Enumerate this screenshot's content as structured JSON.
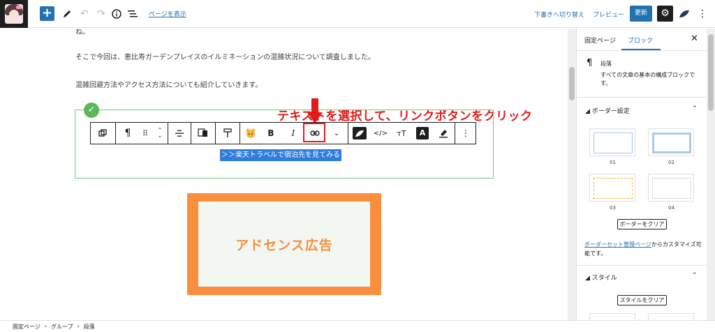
{
  "topbar": {
    "add_icon": "plus-icon",
    "view_page_label": "ページを表示",
    "save_draft_label": "下書きへ切り替え",
    "preview_label": "プレビュー",
    "update_label": "更新"
  },
  "content": {
    "partial_text": "ね。",
    "para1": "そこで今回は、恵比寿ガーデンプレイスのイルミネーションの混雑状況について調査しました。",
    "para2": "混雑回避方法やアクセス方法についても紹介していきます。",
    "annotation": "テキストを選択して、リンクボタンをクリック",
    "selected_link_text": "＞＞楽天トラベルで宿泊先を見てみる",
    "ad_label": "アドセンス広告"
  },
  "toolbar": {
    "bold_label": "B",
    "italic_label": "I",
    "text_color_label": "A"
  },
  "sidebar": {
    "tab_page": "固定ページ",
    "tab_block": "ブロック",
    "block_title": "段落",
    "block_desc": "すべての文章の基本の構成ブロックです。",
    "border_section": "ボーダー設定",
    "border_thumbs": [
      "01",
      "02",
      "03",
      "04"
    ],
    "clear_border": "ボーダーをクリア",
    "border_manage_link": "ボーダーセット管理ページ",
    "border_manage_rest": "からカスタマイズ可能です。",
    "style_section": "スタイル",
    "clear_style": "スタイルをクリア"
  },
  "breadcrumb": [
    "固定ページ",
    "グループ",
    "段落"
  ],
  "colors": {
    "accent": "#2271b1",
    "annotation_red": "#e11b1b",
    "selection_blue": "#2e7cdc",
    "ad_orange": "#f98f3e",
    "group_border": "#7ac47a"
  }
}
